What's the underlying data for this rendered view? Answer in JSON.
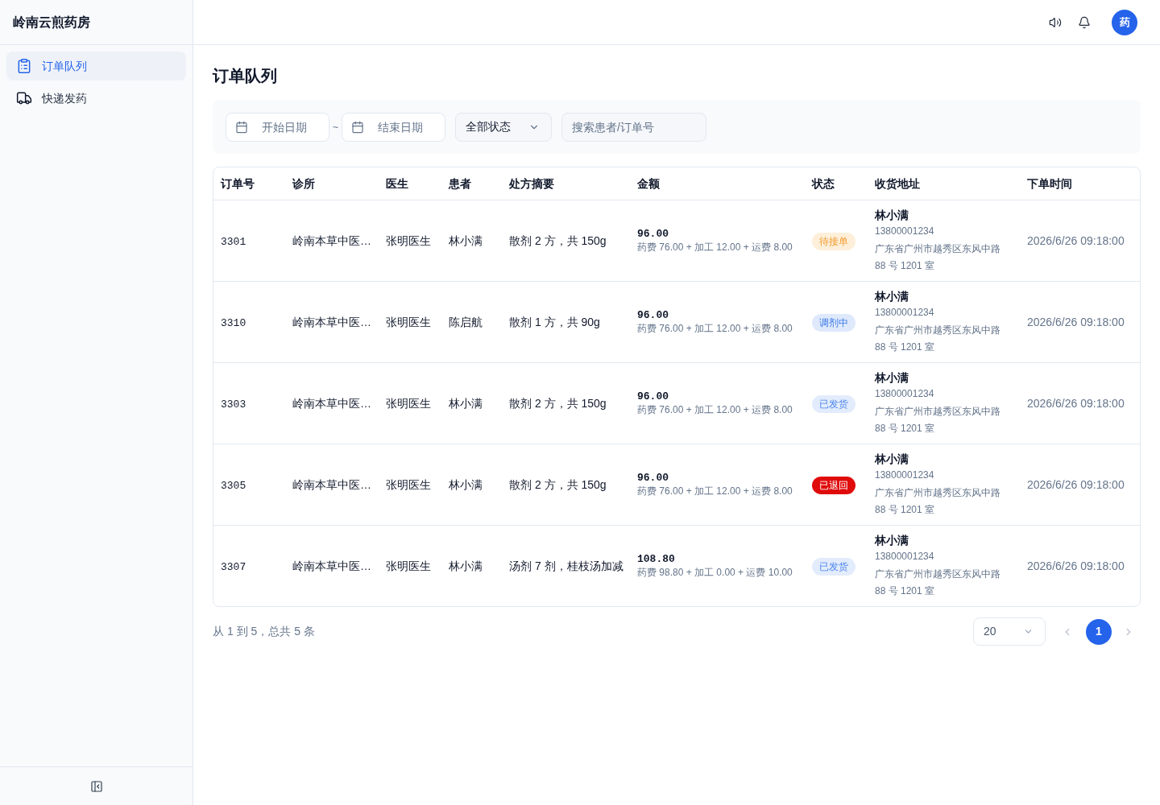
{
  "app": {
    "title": "岭南云煎药房"
  },
  "sidebar": {
    "items": [
      {
        "label": "订单队列",
        "selected": true
      },
      {
        "label": "快递发药",
        "selected": false
      }
    ]
  },
  "header": {
    "avatar": "药"
  },
  "page": {
    "title": "订单队列"
  },
  "filters": {
    "start_date": {
      "placeholder": "开始日期"
    },
    "separator": "~",
    "end_date": {
      "placeholder": "结束日期"
    },
    "status_select": {
      "value": "全部状态"
    },
    "search": {
      "placeholder": "搜索患者/订单号"
    }
  },
  "table": {
    "columns": [
      "订单号",
      "诊所",
      "医生",
      "患者",
      "处方摘要",
      "金额",
      "状态",
      "收货地址",
      "下单时间"
    ],
    "rows": [
      {
        "order_no": "3301",
        "clinic": "岭南本草中医…",
        "doctor": "张明医生",
        "patient": "林小满",
        "prescription": "散剂 2 方，共 150g",
        "amount": {
          "total": "96.00",
          "breakdown": "药费 76.00 + 加工 12.00 + 运费 8.00"
        },
        "status": {
          "label": "待接单",
          "kind": "pending"
        },
        "recipient": {
          "name": "林小满",
          "phone": "13800001234",
          "address": "广东省广州市越秀区东风中路 88 号 1201 室"
        },
        "created_at": "2026/6/26 09:18:00"
      },
      {
        "order_no": "3310",
        "clinic": "岭南本草中医…",
        "doctor": "张明医生",
        "patient": "陈启航",
        "prescription": "散剂 1 方，共 90g",
        "amount": {
          "total": "96.00",
          "breakdown": "药费 76.00 + 加工 12.00 + 运费 8.00"
        },
        "status": {
          "label": "调剂中",
          "kind": "dispensing"
        },
        "recipient": {
          "name": "林小满",
          "phone": "13800001234",
          "address": "广东省广州市越秀区东风中路 88 号 1201 室"
        },
        "created_at": "2026/6/26 09:18:00"
      },
      {
        "order_no": "3303",
        "clinic": "岭南本草中医…",
        "doctor": "张明医生",
        "patient": "林小满",
        "prescription": "散剂 2 方，共 150g",
        "amount": {
          "total": "96.00",
          "breakdown": "药费 76.00 + 加工 12.00 + 运费 8.00"
        },
        "status": {
          "label": "已发货",
          "kind": "shipped"
        },
        "recipient": {
          "name": "林小满",
          "phone": "13800001234",
          "address": "广东省广州市越秀区东风中路 88 号 1201 室"
        },
        "created_at": "2026/6/26 09:18:00"
      },
      {
        "order_no": "3305",
        "clinic": "岭南本草中医…",
        "doctor": "张明医生",
        "patient": "林小满",
        "prescription": "散剂 2 方，共 150g",
        "amount": {
          "total": "96.00",
          "breakdown": "药费 76.00 + 加工 12.00 + 运费 8.00"
        },
        "status": {
          "label": "已退回",
          "kind": "returned"
        },
        "recipient": {
          "name": "林小满",
          "phone": "13800001234",
          "address": "广东省广州市越秀区东风中路 88 号 1201 室"
        },
        "created_at": "2026/6/26 09:18:00"
      },
      {
        "order_no": "3307",
        "clinic": "岭南本草中医…",
        "doctor": "张明医生",
        "patient": "林小满",
        "prescription": "汤剂 7 剂，桂枝汤加减",
        "amount": {
          "total": "108.80",
          "breakdown": "药费 98.80 + 加工 0.00 + 运费 10.00"
        },
        "status": {
          "label": "已发货",
          "kind": "shipped"
        },
        "recipient": {
          "name": "林小满",
          "phone": "13800001234",
          "address": "广东省广州市越秀区东风中路 88 号 1201 室"
        },
        "created_at": "2026/6/26 09:18:00"
      }
    ]
  },
  "pagination": {
    "summary": "从 1 到 5，总共 5 条",
    "page_size": {
      "value": "20"
    },
    "prev_button": {
      "disabled": true
    },
    "pages": [
      {
        "label": "1",
        "selected": true
      }
    ],
    "next_button": {
      "disabled": true
    }
  }
}
